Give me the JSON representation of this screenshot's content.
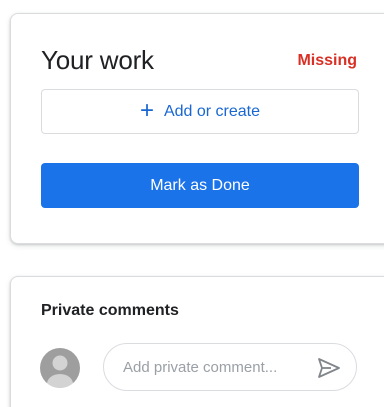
{
  "work": {
    "title": "Your work",
    "status": "Missing",
    "add_button": {
      "icon": "plus-icon",
      "symbol": "+",
      "label": "Add or create"
    },
    "done_button_label": "Mark as Done"
  },
  "comments": {
    "title": "Private comments",
    "avatar_icon": "person-avatar-icon",
    "input_placeholder": "Add private comment...",
    "input_value": "",
    "send_icon": "send-icon"
  },
  "colors": {
    "accent": "#1a73e8",
    "link_blue": "#1967d2",
    "missing_red": "#d93025",
    "border": "#dadce0"
  }
}
